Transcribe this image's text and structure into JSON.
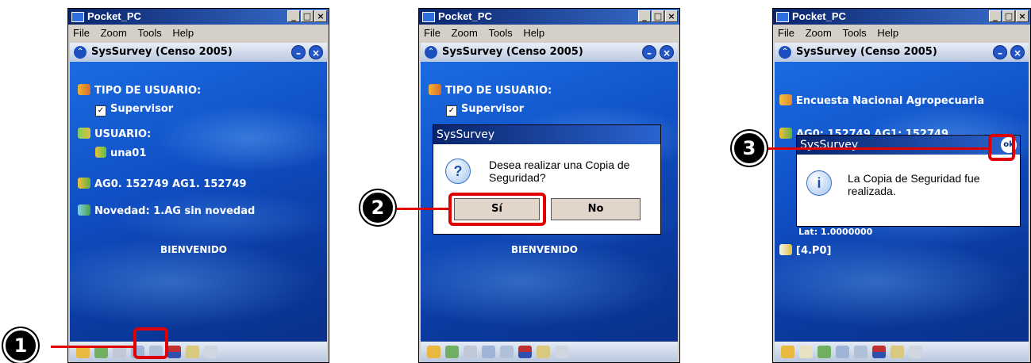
{
  "window_title": "Pocket_PC",
  "window_buttons": [
    "_",
    "□",
    "×"
  ],
  "menu": [
    "File",
    "Zoom",
    "Tools",
    "Help"
  ],
  "app_title": "SysSurvey (Censo 2005)",
  "screen1": {
    "user_type_label": "TIPO DE USUARIO:",
    "user_type_value": "Supervisor",
    "user_label": "USUARIO:",
    "user_value": "una01",
    "ag_line": "AG0. 152749    AG1. 152749",
    "novedad": "Novedad:  1.AG sin novedad",
    "welcome": "BIENVENIDO"
  },
  "screen2": {
    "user_type_label": "TIPO DE USUARIO:",
    "user_type_value": "Supervisor",
    "welcome": "BIENVENIDO",
    "dialog_title": "SysSurvey",
    "dialog_icon": "?",
    "dialog_message": "Desea realizar una Copia de Seguridad?",
    "btn_yes": "Sí",
    "btn_no": "No"
  },
  "screen3": {
    "survey_title": "Encuesta Nacional Agropecuaria",
    "ag_line": "AG0: 152749   AG1: 152749",
    "dialog_title": "SysSurvey",
    "ok_label": "ok",
    "dialog_icon": "i",
    "dialog_message": "La Copia de Seguridad fue realizada.",
    "lat_line": "Lat:  1.0000000",
    "p0_line": "[4.P0]"
  },
  "steps": [
    "1",
    "2",
    "3"
  ],
  "colors": {
    "highlight": "#e00000",
    "titlebar": "#0a246a",
    "screen": "#1050c6"
  }
}
